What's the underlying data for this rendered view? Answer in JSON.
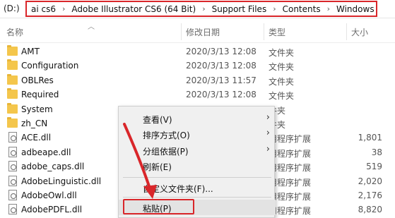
{
  "address_bar": {
    "drive": "(D:)",
    "crumbs": [
      "ai cs6",
      "Adobe Illustrator CS6 (64 Bit)",
      "Support Files",
      "Contents",
      "Windows"
    ],
    "separator": "›"
  },
  "columns": {
    "name": "名称",
    "date": "修改日期",
    "type": "类型",
    "size": "大小",
    "sort_icon": "chevron-up-icon"
  },
  "files": [
    {
      "name": "AMT",
      "date": "2020/3/13 12:08",
      "type": "文件夹",
      "size": "",
      "icon": "folder-icon"
    },
    {
      "name": "Configuration",
      "date": "2020/3/13 12:08",
      "type": "文件夹",
      "size": "",
      "icon": "folder-icon"
    },
    {
      "name": "OBLRes",
      "date": "2020/3/13 11:57",
      "type": "文件夹",
      "size": "",
      "icon": "folder-icon"
    },
    {
      "name": "Required",
      "date": "2020/3/13 12:08",
      "type": "文件夹",
      "size": "",
      "icon": "folder-icon"
    },
    {
      "name": "System",
      "date": "",
      "type": "件夹",
      "size": "",
      "icon": "folder-icon"
    },
    {
      "name": "zh_CN",
      "date": "",
      "type": "件夹",
      "size": "",
      "icon": "folder-icon"
    },
    {
      "name": "ACE.dll",
      "date": "",
      "type": "用程序扩展",
      "size": "1,801",
      "icon": "dll-file-icon"
    },
    {
      "name": "adbeape.dll",
      "date": "",
      "type": "用程序扩展",
      "size": "38",
      "icon": "dll-file-icon"
    },
    {
      "name": "adobe_caps.dll",
      "date": "",
      "type": "用程序扩展",
      "size": "519",
      "icon": "dll-file-icon"
    },
    {
      "name": "AdobeLinguistic.dll",
      "date": "",
      "type": "用程序扩展",
      "size": "2,020",
      "icon": "dll-file-icon"
    },
    {
      "name": "AdobeOwl.dll",
      "date": "",
      "type": "用程序扩展",
      "size": "2,176",
      "icon": "dll-file-icon"
    },
    {
      "name": "AdobePDFL.dll",
      "date": "",
      "type": "用程序扩展",
      "size": "8,820",
      "icon": "dll-file-icon"
    }
  ],
  "context_menu": {
    "items": [
      {
        "label": "查看(V)",
        "submenu": true
      },
      {
        "label": "排序方式(O)",
        "submenu": true
      },
      {
        "label": "分组依据(P)",
        "submenu": true
      },
      {
        "label": "刷新(E)",
        "submenu": false
      },
      {
        "label": "自定义文件夹(F)...",
        "submenu": false
      },
      {
        "label": "粘贴(P)",
        "submenu": false
      }
    ],
    "highlighted": "粘贴(P)"
  },
  "colors": {
    "highlight_red": "#d9262a",
    "folder_yellow": "#f4c64c",
    "menu_bg": "#f0f0f0"
  }
}
